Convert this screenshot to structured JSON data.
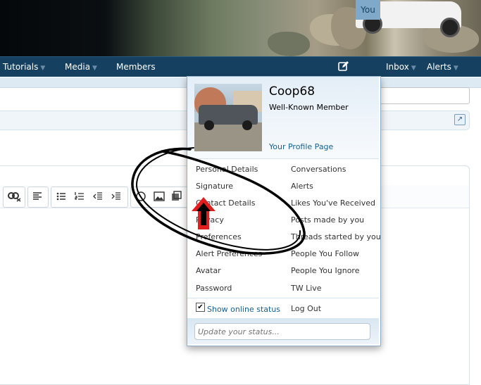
{
  "colors": {
    "nav_bg": "#16405f",
    "you_tab_bg": "#7fa8c9",
    "link": "#176093",
    "annotation_arrow": "#e01e1e"
  },
  "navbar": {
    "tabs": [
      {
        "label": "Tutorials",
        "has_dropdown": true
      },
      {
        "label": "Media",
        "has_dropdown": true
      },
      {
        "label": "Members",
        "has_dropdown": false
      },
      {
        "label": "You",
        "has_dropdown": false,
        "active": true
      },
      {
        "label": "Inbox",
        "has_dropdown": true
      },
      {
        "label": "Alerts",
        "has_dropdown": true
      }
    ],
    "arrow_glyph": "▼",
    "edit_icon": "pencil-square-icon"
  },
  "account_menu": {
    "username": "Coop68",
    "user_title": "Well-Known Member",
    "profile_link": "Your Profile Page",
    "left_column": [
      "Personal Details",
      "Signature",
      "Contact Details",
      "Privacy",
      "Preferences",
      "Alert Preferences",
      "Avatar",
      "Password"
    ],
    "right_column": [
      "Conversations",
      "Alerts",
      "Likes You've Received",
      "Posts made by you",
      "Threads started by you",
      "People You Follow",
      "People You Ignore",
      "TW Live"
    ],
    "show_online_status_label": "Show online status",
    "show_online_status_checked": true,
    "logout_label": "Log Out",
    "status_placeholder": "Update your status..."
  }
}
